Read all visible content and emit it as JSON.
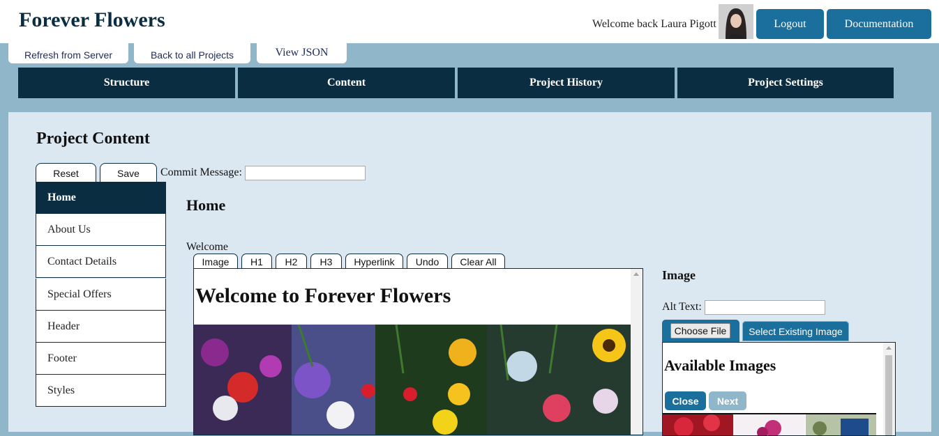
{
  "app": {
    "title": "Forever Flowers",
    "welcome": "Welcome back Laura Pigott",
    "logout_label": "Logout",
    "docs_label": "Documentation"
  },
  "toolbar": {
    "refresh_label": "Refresh from Server",
    "back_label": "Back to all Projects",
    "json_label": "View JSON"
  },
  "main_tabs": [
    "Structure",
    "Content",
    "Project History",
    "Project Settings"
  ],
  "content": {
    "title": "Project Content",
    "reset_label": "Reset",
    "save_label": "Save",
    "commit_label": "Commit Message:",
    "commit_value": ""
  },
  "sidebar": {
    "active": "Home",
    "items": [
      "Home",
      "About Us",
      "Contact Details",
      "Special Offers",
      "Header",
      "Footer",
      "Styles"
    ]
  },
  "page": {
    "heading": "Home",
    "field_label": "Welcome",
    "editor_tabs": [
      "Image",
      "H1",
      "H2",
      "H3",
      "Hyperlink",
      "Undo",
      "Clear All"
    ],
    "editor_heading": "Welcome to Forever Flowers"
  },
  "image_panel": {
    "heading": "Image",
    "alt_label": "Alt Text:",
    "alt_value": "",
    "choose_file_label": "Choose File",
    "select_existing_label": "Select Existing Image",
    "available_heading": "Available Images",
    "close_label": "Close",
    "next_label": "Next"
  },
  "colors": {
    "navy": "#0b2d42",
    "accent_blue": "#1a6f9c",
    "page_bg": "#8fb6c9",
    "panel_bg": "#dce8f1"
  }
}
